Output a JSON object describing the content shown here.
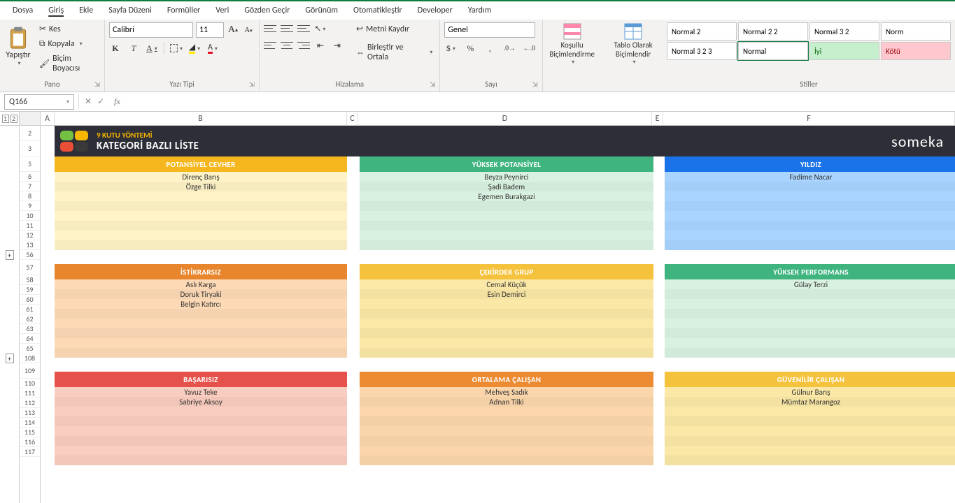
{
  "menu": {
    "items": [
      "Dosya",
      "Giriş",
      "Ekle",
      "Sayfa Düzeni",
      "Formüller",
      "Veri",
      "Gözden Geçir",
      "Görünüm",
      "Otomatikleştir",
      "Developer",
      "Yardım"
    ],
    "active": "Giriş"
  },
  "ribbon": {
    "pano": {
      "paste": "Yapıştır",
      "cut": "Kes",
      "copy": "Kopyala",
      "format_painter": "Biçim Boyacısı",
      "label": "Pano"
    },
    "font": {
      "name": "Calibri",
      "size": "11",
      "label": "Yazı Tipi",
      "bold": "K",
      "italic": "T",
      "underline": "A"
    },
    "alignment": {
      "wrap": "Metni Kaydır",
      "merge": "Birleştir ve Ortala",
      "label": "Hizalama"
    },
    "number": {
      "format": "Genel",
      "label": "Sayı"
    },
    "cond_fmt": {
      "line1": "Koşullu",
      "line2": "Biçimlendirme"
    },
    "tbl_fmt": {
      "line1": "Tablo Olarak",
      "line2": "Biçimlendir"
    },
    "styles": {
      "label": "Stiller",
      "cells": [
        "Normal 2",
        "Normal 2 2",
        "Normal 3 2",
        "Norm",
        "Normal 3 2 3",
        "Normal",
        "İyi",
        "Kötü"
      ]
    }
  },
  "namebox": "Q166",
  "columns": [
    "A",
    "B",
    "C",
    "D",
    "E",
    "F"
  ],
  "row_numbers": [
    "2",
    "3",
    "5",
    "6",
    "7",
    "8",
    "9",
    "10",
    "11",
    "12",
    "13",
    "56",
    "57",
    "58",
    "59",
    "60",
    "61",
    "62",
    "63",
    "64",
    "65",
    "108",
    "109",
    "110",
    "111",
    "112",
    "113",
    "114",
    "115",
    "116",
    "117"
  ],
  "outline": {
    "levels": [
      "1",
      "2"
    ],
    "plus": "+"
  },
  "title_block": {
    "subtitle": "9 KUTU YÖNTEMİ",
    "title": "KATEGORİ BAZLI LİSTE",
    "brand": "someka"
  },
  "categories": {
    "r1c1": {
      "hdr": "POTANSİYEL CEVHER",
      "bg_hdr": "#f5b71d",
      "bg_row": "#fff3c7",
      "rows": [
        "Direnç Barış",
        "Özge Tilki",
        "",
        "",
        "",
        "",
        "",
        ""
      ]
    },
    "r1c2": {
      "hdr": "YÜKSEK POTANSİYEL",
      "bg_hdr": "#3fb47f",
      "bg_row": "#d9f1e1",
      "rows": [
        "Beyza Peynirci",
        "Şadi Badem",
        "Egemen Burakgazi",
        "",
        "",
        "",
        "",
        ""
      ]
    },
    "r1c3": {
      "hdr": "YILDIZ",
      "bg_hdr": "#1a73e8",
      "bg_row": "#a8d4ff",
      "rows": [
        "Fadime Nacar",
        "",
        "",
        "",
        "",
        "",
        "",
        ""
      ]
    },
    "r2c1": {
      "hdr": "İSTİKRARSIZ",
      "bg_hdr": "#e8862d",
      "bg_row": "#fdd9b5",
      "rows": [
        "Aslı Karga",
        "Doruk Tiryaki",
        "Belgin Katırcı",
        "",
        "",
        "",
        "",
        ""
      ]
    },
    "r2c2": {
      "hdr": "ÇEKİRDEK GRUP",
      "bg_hdr": "#f5c23d",
      "bg_row": "#fbe8a6",
      "rows": [
        "Cemal Küçük",
        "Esin Demirci",
        "",
        "",
        "",
        "",
        "",
        ""
      ]
    },
    "r2c3": {
      "hdr": "YÜKSEK PERFORMANS",
      "bg_hdr": "#3fb47f",
      "bg_row": "#d9f1e1",
      "rows": [
        "Gülay Terzi",
        "",
        "",
        "",
        "",
        "",
        "",
        ""
      ]
    },
    "r3c1": {
      "hdr": "BAŞARISIZ",
      "bg_hdr": "#e5524b",
      "bg_row": "#f9cdbf",
      "rows": [
        "Yavuz Teke",
        "Sabriye Aksoy",
        "",
        "",
        "",
        "",
        "",
        ""
      ]
    },
    "r3c2": {
      "hdr": "ORTALAMA ÇALIŞAN",
      "bg_hdr": "#ec8b32",
      "bg_row": "#fbd6ab",
      "rows": [
        "Mehveş Sadık",
        "Adnan Tilki",
        "",
        "",
        "",
        "",
        "",
        ""
      ]
    },
    "r3c3": {
      "hdr": "GÜVENİLİR ÇALIŞAN",
      "bg_hdr": "#f5c23d",
      "bg_row": "#fbe8a6",
      "rows": [
        "Gülnur Barış",
        "Mümtaz Marangoz",
        "",
        "",
        "",
        "",
        "",
        ""
      ]
    }
  }
}
